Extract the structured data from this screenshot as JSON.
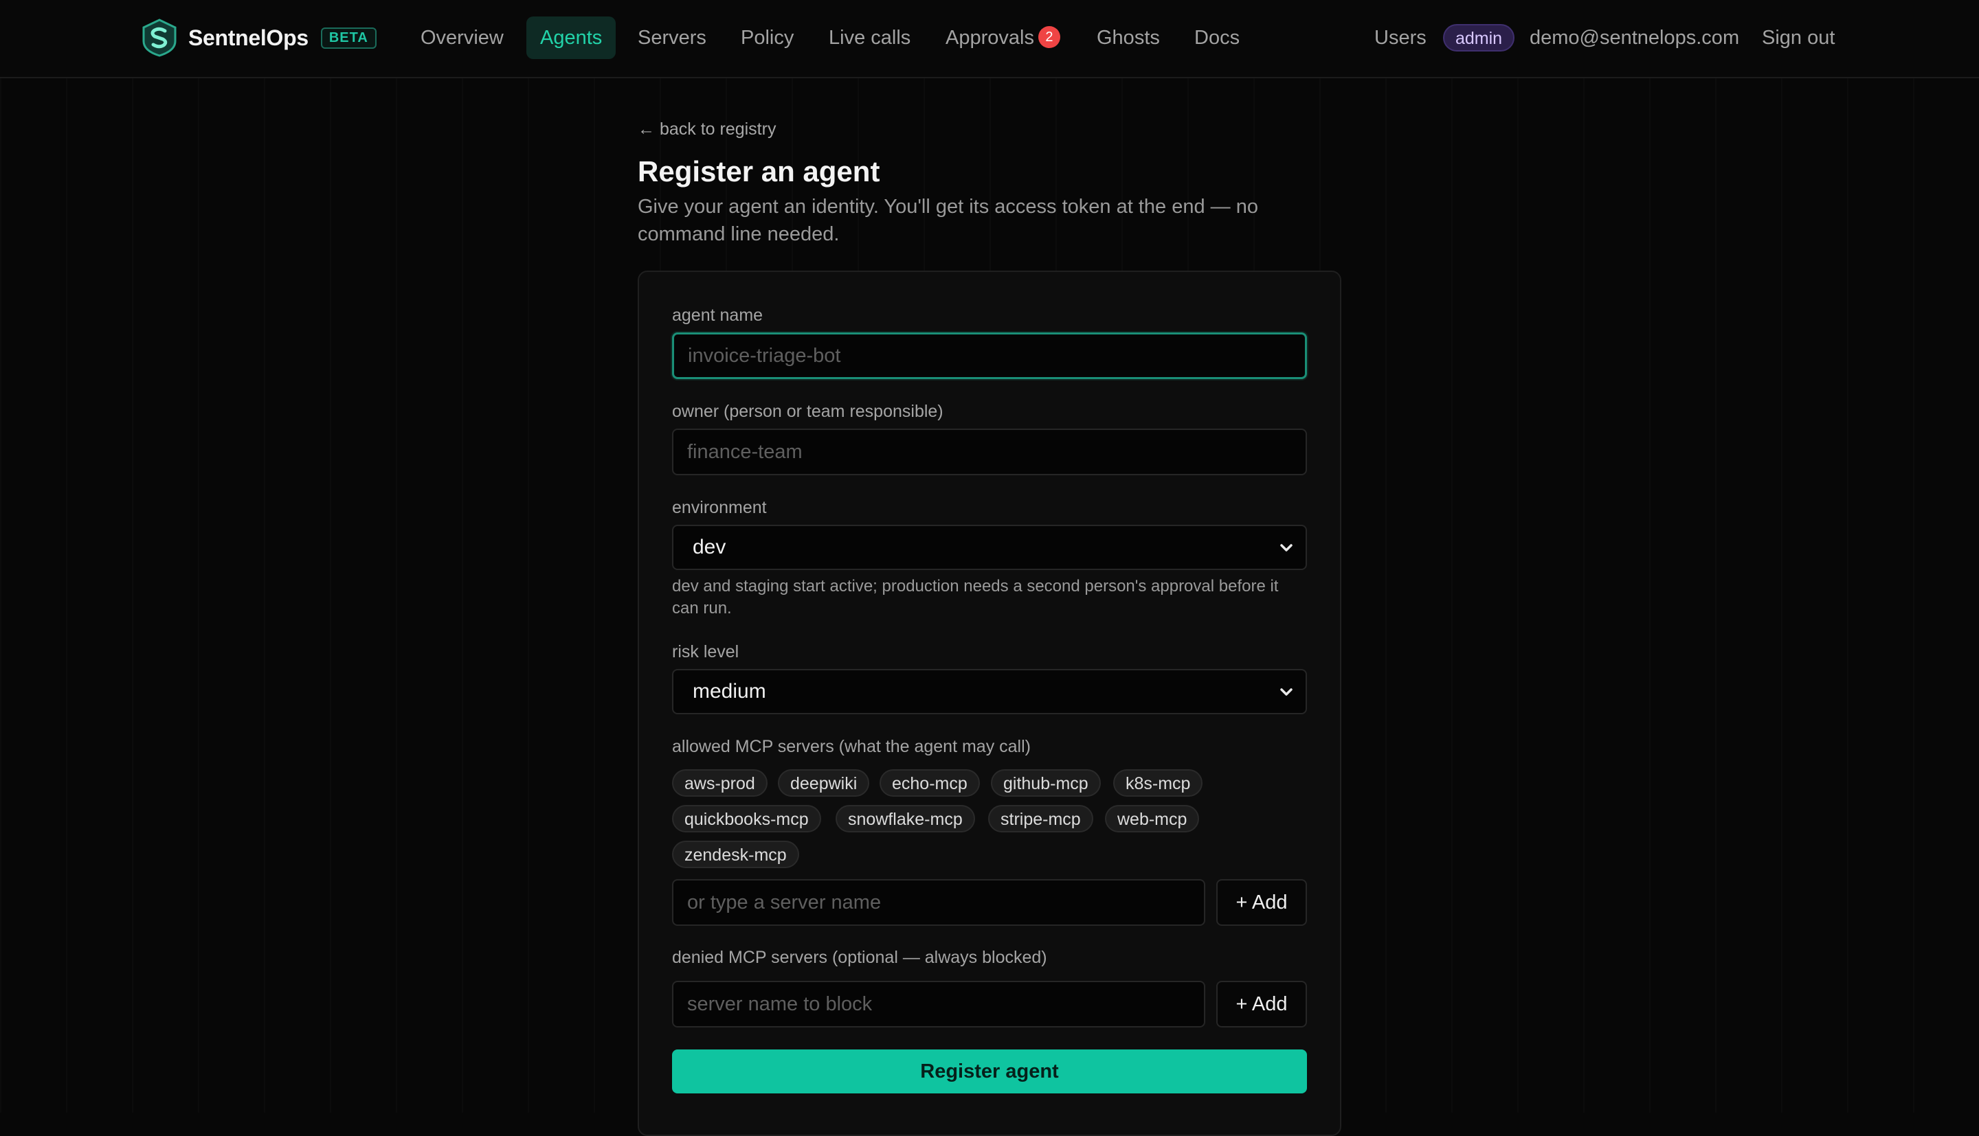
{
  "brand": {
    "name": "SentnelOps",
    "badge": "BETA",
    "accent": "#22d3a9"
  },
  "nav": {
    "items": [
      {
        "label": "Overview"
      },
      {
        "label": "Agents",
        "active": true
      },
      {
        "label": "Servers"
      },
      {
        "label": "Policy"
      },
      {
        "label": "Live calls"
      },
      {
        "label": "Approvals",
        "badge": "2"
      },
      {
        "label": "Ghosts"
      },
      {
        "label": "Docs"
      }
    ],
    "users_label": "Users",
    "role": "admin",
    "email": "demo@sentnelops.com",
    "sign_out": "Sign out"
  },
  "page": {
    "back_link": "← back to registry",
    "title": "Register an agent",
    "subtitle": "Give your agent an identity. You'll get its access token at the end — no command line needed."
  },
  "form": {
    "agent_name": {
      "label": "agent name",
      "placeholder": "invoice-triage-bot",
      "value": ""
    },
    "owner": {
      "label": "owner (person or team responsible)",
      "placeholder": "finance-team",
      "value": ""
    },
    "environment": {
      "label": "environment",
      "selected": "dev",
      "hint": "dev and staging start active; production needs a second person's approval before it can run."
    },
    "risk_level": {
      "label": "risk level",
      "selected": "medium"
    },
    "allowed_servers": {
      "label": "allowed MCP servers (what the agent may call)",
      "chips": [
        "aws-prod",
        "deepwiki",
        "echo-mcp",
        "github-mcp",
        "k8s-mcp",
        "quickbooks-mcp",
        "snowflake-mcp",
        "stripe-mcp",
        "web-mcp",
        "zendesk-mcp"
      ],
      "placeholder": "or type a server name",
      "add_label": "+ Add"
    },
    "denied_servers": {
      "label": "denied MCP servers (optional — always blocked)",
      "placeholder": "server name to block",
      "add_label": "+ Add"
    },
    "submit_label": "Register agent",
    "submit_color": "#0fc4a0"
  }
}
